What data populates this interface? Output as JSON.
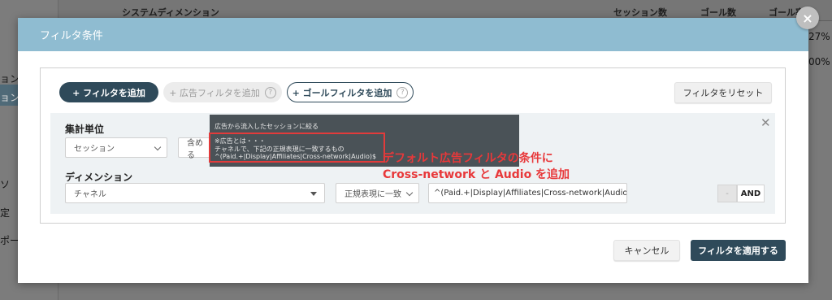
{
  "background": {
    "table_header_label": "システムディメンション",
    "col_sessions": "セッション数",
    "col_goals": "ゴール数",
    "col_goal_rate": "ゴール率",
    "row1_value": "27%",
    "row2_value": "00%",
    "side_items": [
      "ョン",
      "ョン",
      "ソ",
      "定",
      "ポート"
    ]
  },
  "modal": {
    "title": "フィルタ条件",
    "close_icon": "×",
    "buttons": {
      "add_filter": "+ フィルタを追加",
      "add_ad_filter": "+ 広告フィルタを追加",
      "add_goal_filter": "+ ゴールフィルタを追加",
      "reset": "フィルタをリセット",
      "cancel": "キャンセル",
      "apply": "フィルタを適用する",
      "help": "?"
    },
    "panel": {
      "aggregation_label": "集計単位",
      "aggregation_value": "セッション",
      "include_value": "含める",
      "dimension_label": "ディメンション",
      "dimension_value": "チャネル",
      "match_type": "正規表現に一致",
      "regex_value": "^(Paid.+|Display|Affiliates|Cross-network|Audio)$",
      "minus_label": "-",
      "and_label": "AND",
      "panel_close": "✕"
    },
    "tooltip": {
      "title": "広告から流入したセッションに絞る",
      "line1": "※広告とは・・・",
      "line2": "チャネルで、下記の正規表現に一致するもの",
      "line3": "^(Paid.+|Display|Affiliates|Cross-network|Audio)$"
    },
    "annotation": {
      "line1": "デフォルト広告フィルタの条件に",
      "line2": "Cross-network と Audio を追加"
    }
  }
}
